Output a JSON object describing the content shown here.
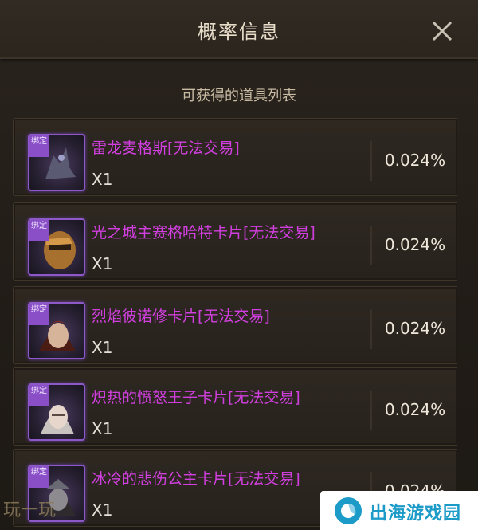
{
  "dialog": {
    "title": "概率信息",
    "subtitle": "可获得的道具列表",
    "close_icon": "close-icon"
  },
  "items": [
    {
      "name": "雷龙麦格斯[无法交易]",
      "qty": "X1",
      "prob": "0.024%",
      "tag": "绑定"
    },
    {
      "name": "光之城主赛格哈特卡片[无法交易]",
      "qty": "X1",
      "prob": "0.024%",
      "tag": "绑定"
    },
    {
      "name": "烈焰彼诺修卡片[无法交易]",
      "qty": "X1",
      "prob": "0.024%",
      "tag": "绑定"
    },
    {
      "name": "炽热的愤怒王子卡片[无法交易]",
      "qty": "X1",
      "prob": "0.024%",
      "tag": "绑定"
    },
    {
      "name": "冰冷的悲伤公主卡片[无法交易]",
      "qty": "X1",
      "prob": "0.024%",
      "tag": "绑定"
    }
  ],
  "watermarks": {
    "left": "玩一玩",
    "right": "出海游戏园"
  },
  "colors": {
    "item_name": "#d23fe0",
    "frame_purple": "#8d59c8",
    "text_light": "#efe7da",
    "brand_blue": "#1c9bc8"
  }
}
